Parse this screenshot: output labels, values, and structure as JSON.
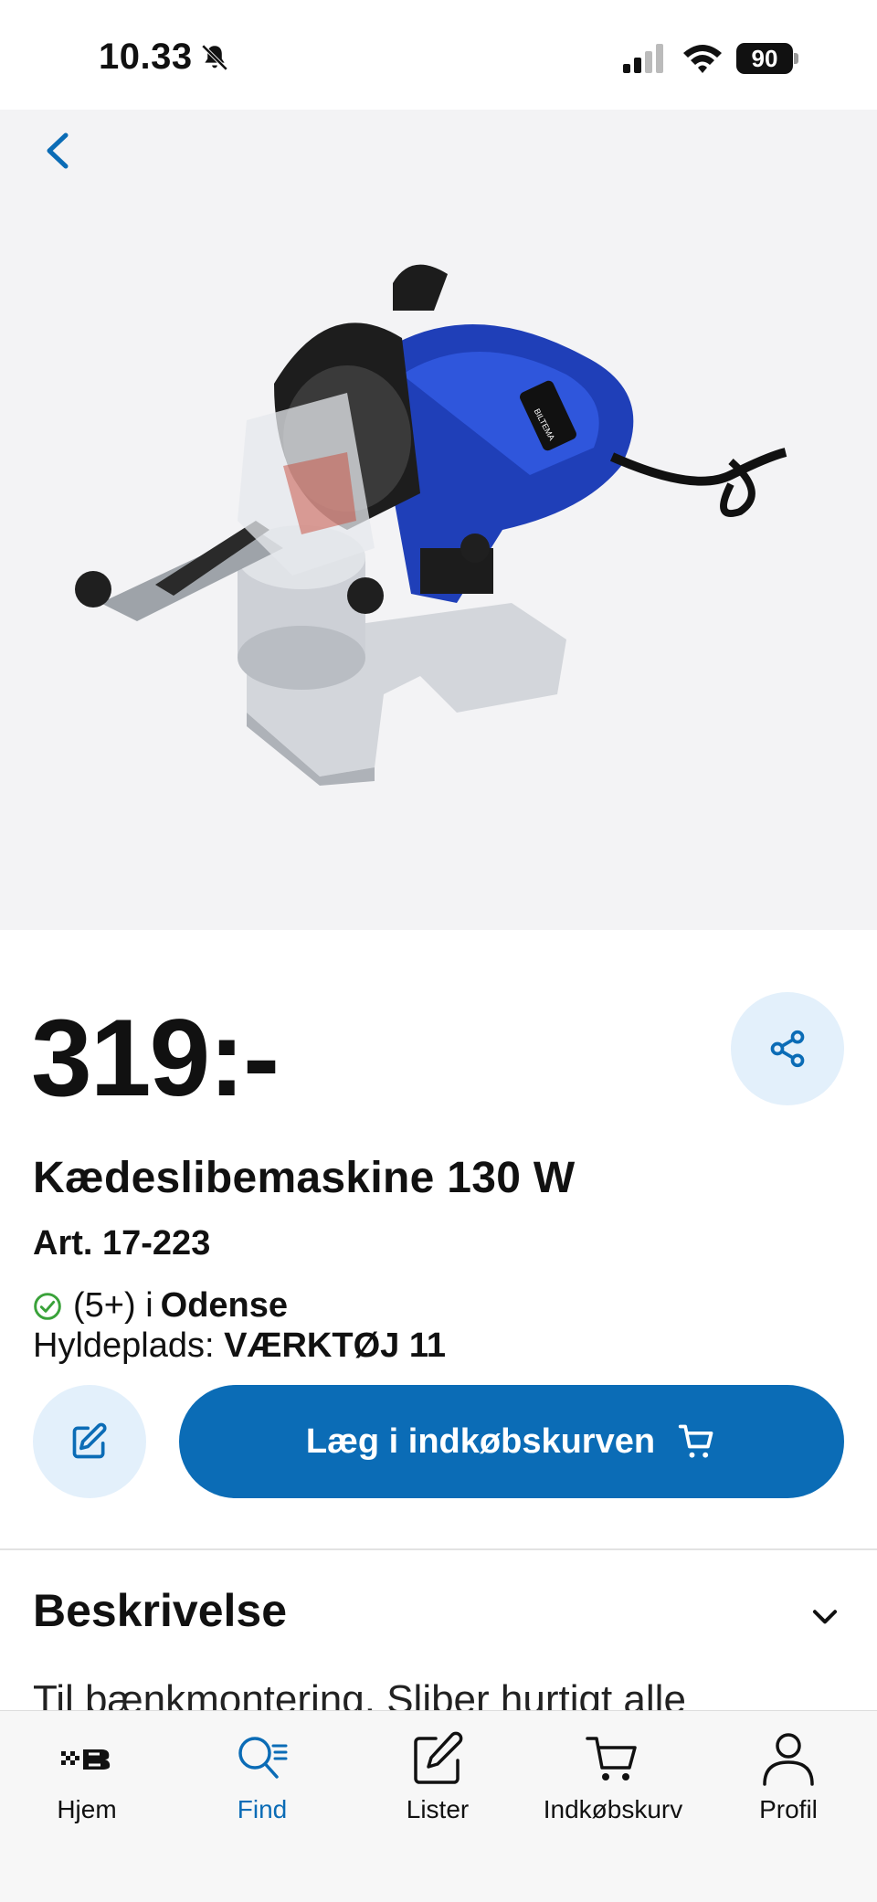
{
  "status_bar": {
    "time": "10.33",
    "battery": "90"
  },
  "product": {
    "price": "319:-",
    "title": "Kædeslibemaskine 130 W",
    "article": "Art. 17-223",
    "stock_count": "(5+) i",
    "stock_city": "Odense",
    "shelf_label": "Hyldeplads:",
    "shelf_value": "VÆRKTØJ 11",
    "image_brand_text": "BILTEMA"
  },
  "actions": {
    "add_to_cart": "Læg i indkøbskurven"
  },
  "description": {
    "title": "Beskrivelse",
    "text": "Til bænkmontering. Sliber hurtigt alle"
  },
  "tabbar": {
    "items": [
      {
        "label": "Hjem",
        "icon": "home-logo-icon"
      },
      {
        "label": "Find",
        "icon": "search-icon"
      },
      {
        "label": "Lister",
        "icon": "edit-list-icon"
      },
      {
        "label": "Indkøbskurv",
        "icon": "cart-icon"
      },
      {
        "label": "Profil",
        "icon": "profile-icon"
      }
    ],
    "active": "Find"
  },
  "colors": {
    "accent": "#0b6cb6",
    "accent_light": "#e3f0fb",
    "stock_green": "#3aa23a"
  }
}
